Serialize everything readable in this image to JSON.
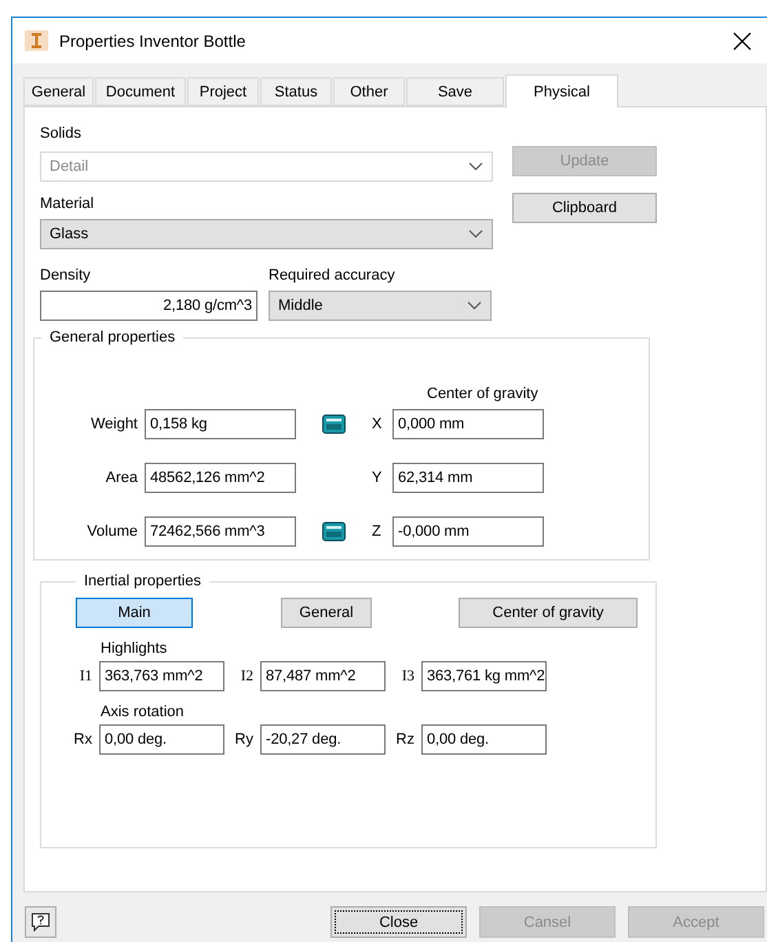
{
  "window": {
    "title": "Properties Inventor Bottle"
  },
  "tabs": [
    {
      "label": "General",
      "selected": false
    },
    {
      "label": "Document",
      "selected": false
    },
    {
      "label": "Project",
      "selected": false
    },
    {
      "label": "Status",
      "selected": false
    },
    {
      "label": "Other",
      "selected": false
    },
    {
      "label": "Save",
      "selected": false
    },
    {
      "label": "Physical",
      "selected": true
    }
  ],
  "solids": {
    "label": "Solids",
    "value": "Detail",
    "disabled": true
  },
  "material": {
    "label": "Material",
    "value": "Glass",
    "disabled": false
  },
  "side_buttons": [
    {
      "label": "Update",
      "disabled": true
    },
    {
      "label": "Clipboard",
      "disabled": false
    }
  ],
  "density": {
    "label": "Density",
    "value": "2,180 g/cm^3"
  },
  "accuracy": {
    "label": "Required accuracy",
    "value": "Middle"
  },
  "general_properties": {
    "title": "General properties",
    "center_label": "Center of gravity",
    "rows": [
      {
        "label": "Weight",
        "value": "0,158 kg",
        "calculator": true,
        "axis": "X",
        "axis_value": "0,000 mm"
      },
      {
        "label": "Area",
        "value": "48562,126 mm^2",
        "calculator": false,
        "axis": "Y",
        "axis_value": "62,314 mm"
      },
      {
        "label": "Volume",
        "value": "72462,566 mm^3",
        "calculator": true,
        "axis": "Z",
        "axis_value": "-0,000 mm"
      }
    ]
  },
  "inertial_properties": {
    "title": "Inertial properties",
    "views": [
      {
        "label": "Main",
        "selected": true
      },
      {
        "label": "General",
        "selected": false
      },
      {
        "label": "Center of gravity",
        "selected": false
      }
    ],
    "highlights": {
      "label": "Highlights",
      "items": [
        {
          "label": "I1",
          "value": "363,763 mm^2"
        },
        {
          "label": "I2",
          "value": "87,487 mm^2"
        },
        {
          "label": "I3",
          "value": "363,761 kg mm^2"
        }
      ]
    },
    "axis_rotation": {
      "label": "Axis rotation",
      "items": [
        {
          "label": "Rx",
          "value": "0,00 deg."
        },
        {
          "label": "Ry",
          "value": "-20,27 deg."
        },
        {
          "label": "Rz",
          "value": "0,00 deg."
        }
      ]
    }
  },
  "footer_buttons": [
    {
      "label": "Close",
      "disabled": false,
      "focused": true
    },
    {
      "label": "Cansel",
      "disabled": true,
      "focused": false
    },
    {
      "label": "Accept",
      "disabled": true,
      "focused": false
    }
  ]
}
